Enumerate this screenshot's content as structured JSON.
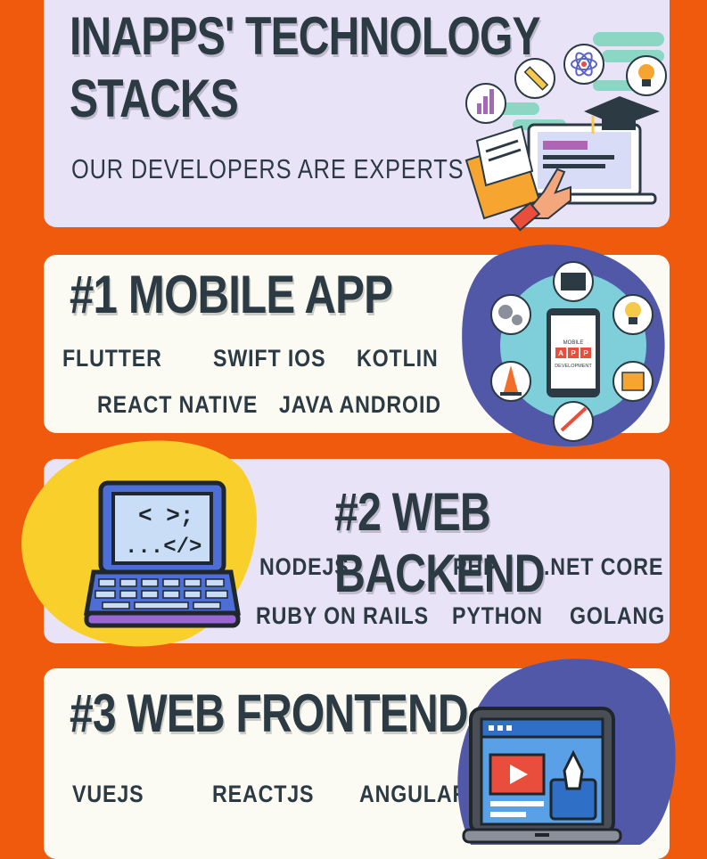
{
  "header": {
    "title_line1": "INAPPS' TECHNOLOGY",
    "title_line2": "STACKS",
    "subtitle": "OUR DEVELOPERS ARE EXPERTS IN:"
  },
  "sections": [
    {
      "title": "#1 MOBILE APP",
      "techs": [
        "FLUTTER",
        "SWIFT IOS",
        "KOTLIN",
        "REACT NATIVE",
        "JAVA ANDROID"
      ],
      "illustration_text": [
        "MOBILE",
        "A",
        "P",
        "P",
        "DEVELOPMENT"
      ]
    },
    {
      "title": "#2 WEB BACKEND",
      "techs": [
        "NODEJS",
        "PHP",
        ".NET CORE",
        "RUBY ON RAILS",
        "PYTHON",
        "GOLANG"
      ]
    },
    {
      "title": "#3 WEB FRONTEND",
      "techs": [
        "VUEJS",
        "REACTJS",
        "ANGULAR"
      ]
    }
  ],
  "colors": {
    "background": "#ef5a0c",
    "card_lavender": "#e9e3f8",
    "card_cream": "#fbfbf3",
    "text_dark": "#2c3a44",
    "blob_blue": "#5158a8",
    "blob_yellow": "#f9cf2b"
  },
  "icons": [
    "education-illustration",
    "mobile-app-illustration",
    "code-laptop-icon",
    "web-frontend-laptop-icon"
  ]
}
